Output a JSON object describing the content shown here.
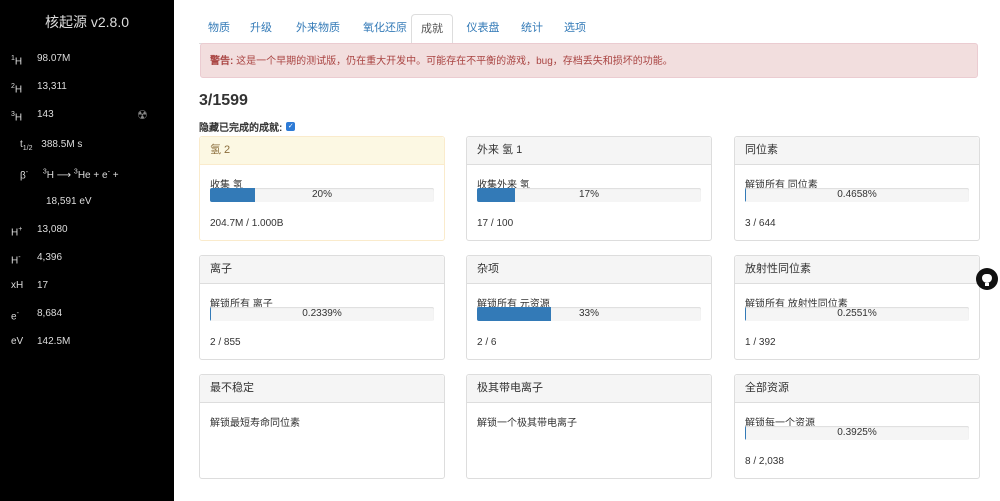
{
  "sidebar": {
    "title": "核起源 v2.8.0",
    "resources": [
      {
        "sup": "1",
        "name": "H",
        "value": "98.07M"
      },
      {
        "sup": "2",
        "name": "H",
        "value": "13,311"
      },
      {
        "sup": "3",
        "name": "H",
        "value": "143"
      }
    ],
    "decay": {
      "half_life_label": "t",
      "half_life_sub": "1/2",
      "half_life_value": "388.5M s",
      "beta": "β",
      "beta_sup": "-",
      "reaction_a": "H ⟶",
      "reaction_a_sup": "3",
      "reaction_b": "He + e",
      "reaction_b_sup_he": "3",
      "reaction_b_sup_e": "-",
      "reaction_tail": " +",
      "energy": "18,591 eV"
    },
    "others": [
      {
        "name": "H",
        "sup": "+",
        "value": "13,080"
      },
      {
        "name": "H",
        "sup": "-",
        "value": "4,396"
      },
      {
        "name": "xH",
        "sup": "",
        "value": "17"
      },
      {
        "name": "e",
        "sup": "-",
        "value": "8,684"
      },
      {
        "name": "eV",
        "sup": "",
        "value": "142.5M"
      }
    ],
    "radiation_icon": "radiation-icon"
  },
  "tabs": [
    "物质",
    "升级",
    "外来物质",
    "氧化还原",
    "成就",
    "仪表盘",
    "统计",
    "选项"
  ],
  "active_tab": "成就",
  "alert": {
    "bold": "警告:",
    "text": " 这是一个早期的测试版，仍在重大开发中。可能存在不平衡的游戏，bug，存档丢失和损坏的功能。"
  },
  "achievements_count": "3/1599",
  "hide_completed_label": "隐藏已完成的成就:",
  "hide_completed_checked": true,
  "cards": [
    {
      "title": "氢 2",
      "desc": "收集 氢",
      "progress": 0.2,
      "progress_label": "20%",
      "foot": "204.7M / 1.000B",
      "complete": true
    },
    {
      "title": "外来 氢 1",
      "desc": "收集外来 氢",
      "progress": 0.17,
      "progress_label": "17%",
      "foot": "17 / 100",
      "complete": false
    },
    {
      "title": "同位素",
      "desc": "解锁所有 同位素",
      "progress": 0.004658,
      "progress_label": "0.4658%",
      "foot": "3 / 644",
      "complete": false
    },
    {
      "title": "离子",
      "desc": "解锁所有 离子",
      "progress": 0.002339,
      "progress_label": "0.2339%",
      "foot": "2 / 855",
      "complete": false
    },
    {
      "title": "杂项",
      "desc": "解锁所有 元资源",
      "progress": 0.33,
      "progress_label": "33%",
      "foot": "2 / 6",
      "complete": false
    },
    {
      "title": "放射性同位素",
      "desc": "解锁所有 放射性同位素",
      "progress": 0.002551,
      "progress_label": "0.2551%",
      "foot": "1 / 392",
      "complete": false
    },
    {
      "title": "最不稳定",
      "desc": "解锁最短寿命同位素",
      "progress": null,
      "progress_label": "",
      "foot": "",
      "complete": false
    },
    {
      "title": "极其带电离子",
      "desc": "解锁一个极其带电离子",
      "progress": null,
      "progress_label": "",
      "foot": "",
      "complete": false
    },
    {
      "title": "全部资源",
      "desc": "解锁每一个资源",
      "progress": 0.003925,
      "progress_label": "0.3925%",
      "foot": "8 / 2,038",
      "complete": false
    }
  ],
  "colors": {
    "accent": "#337ab7",
    "alert_bg": "#f2dede",
    "alert_text": "#a94442",
    "sidebar_bg": "#000000"
  },
  "github_icon": "github-icon"
}
